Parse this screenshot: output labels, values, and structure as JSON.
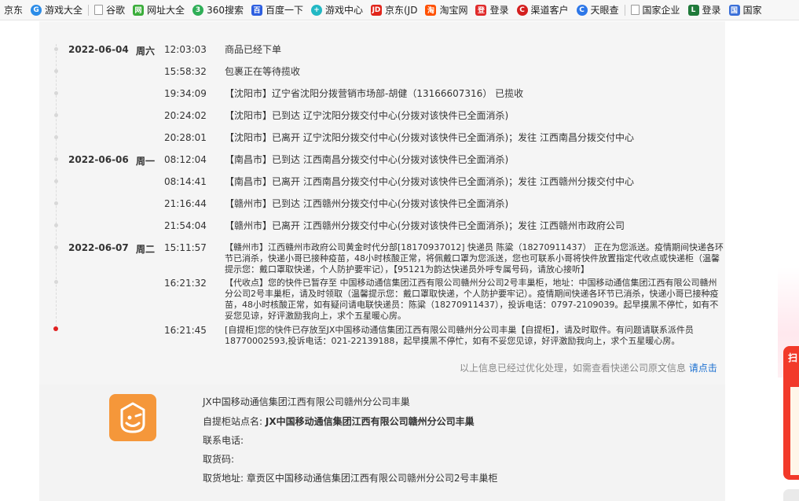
{
  "bookmarks": [
    {
      "label": "京东",
      "color": "#e1251b",
      "ico": ""
    },
    {
      "label": "游戏大全",
      "color": "#2b8ce8",
      "ico": "G"
    },
    {
      "label": "谷歌",
      "color": "",
      "ico": "doc"
    },
    {
      "label": "网址大全",
      "color": "#3cae3c",
      "ico": "网"
    },
    {
      "label": "360搜索",
      "color": "#2fae57",
      "ico": "3"
    },
    {
      "label": "百度一下",
      "color": "#2e5fe0",
      "ico": "百"
    },
    {
      "label": "游戏中心",
      "color": "#22b8c4",
      "ico": "+"
    },
    {
      "label": "京东(JD",
      "color": "#e1251b",
      "ico": "JD"
    },
    {
      "label": "淘宝网",
      "color": "#ff5000",
      "ico": "淘"
    },
    {
      "label": "登录",
      "color": "#e02b2b",
      "ico": "登"
    },
    {
      "label": "渠道客户",
      "color": "#d42020",
      "ico": "C"
    },
    {
      "label": "天眼查",
      "color": "#2d77e8",
      "ico": "C"
    },
    {
      "label": "国家企业",
      "color": "",
      "ico": "doc"
    },
    {
      "label": "登录",
      "color": "#1f7a3a",
      "ico": "L"
    },
    {
      "label": "国家",
      "color": "#3a6fd8",
      "ico": "国"
    }
  ],
  "timeline": {
    "groups": [
      {
        "date": "2022-06-04",
        "weekday": "周六"
      },
      {
        "date": "2022-06-06",
        "weekday": "周一"
      },
      {
        "date": "2022-06-07",
        "weekday": "周二"
      }
    ],
    "events": [
      {
        "time": "12:03:03",
        "text": "商品已经下单"
      },
      {
        "time": "15:58:32",
        "text": "包裹正在等待揽收"
      },
      {
        "time": "19:34:09",
        "text": "【沈阳市】辽宁省沈阳分拨营销市场部-胡健（13166607316） 已揽收"
      },
      {
        "time": "20:24:02",
        "text": "【沈阳市】已到达 辽宁沈阳分拨交付中心(分拨对该快件已全面消杀)"
      },
      {
        "time": "20:28:01",
        "text": "【沈阳市】已离开 辽宁沈阳分拨交付中心(分拨对该快件已全面消杀)；发往 江西南昌分拨交付中心"
      },
      {
        "time": "08:12:04",
        "text": "【南昌市】已到达 江西南昌分拨交付中心(分拨对该快件已全面消杀)"
      },
      {
        "time": "08:14:41",
        "text": "【南昌市】已离开 江西南昌分拨交付中心(分拨对该快件已全面消杀)；发往 江西赣州分拨交付中心"
      },
      {
        "time": "21:16:44",
        "text": "【赣州市】已到达 江西赣州分拨交付中心(分拨对该快件已全面消杀)"
      },
      {
        "time": "21:54:04",
        "text": "【赣州市】已离开 江西赣州分拨交付中心(分拨对该快件已全面消杀)；发往 江西赣州市政府公司"
      },
      {
        "time": "15:11:57",
        "text": "【赣州市】江西赣州市政府公司黄金时代分部[18170937012] 快递员 陈粱（18270911437） 正在为您派送。疫情期间快递各环节已消杀，快递小哥已接种疫苗，48小时核酸正常，将佩戴口罩为您派送，您也可联系小哥将快件放置指定代收点或快递柜（温馨提示您：戴口罩取快递，个人防护要牢记），【95121为韵达快递员外呼专属号码，请放心接听】"
      },
      {
        "time": "16:21:32",
        "text": "【代收点】您的快件已暂存至 中国移动通信集团江西有限公司赣州分公司2号丰巢柜，地址：中国移动通信集团江西有限公司赣州分公司2号丰巢柜，请及时领取（温馨提示您：戴口罩取快递，个人防护要牢记）。疫情期间快递各环节已消杀，快递小哥已接种疫苗，48小时核酸正常，如有疑问请电联快递员：陈粱（18270911437），投诉电话：0797-2109039。起早摸黑不停忙，如有不妥您见谅，好评激励我向上，求个五星暖心房。"
      },
      {
        "time": "16:21:45",
        "text": "[自提柜]您的快件已存放至JX中国移动通信集团江西有限公司赣州分公司丰巢【自提柜】，请及时取件。有问题请联系派件员18770002593,投诉电话：021-22139188，起早摸黑不停忙，如有不妥您见谅，好评激励我向上，求个五星暖心房。"
      }
    ]
  },
  "note": {
    "text": "以上信息已经过优化处理，如需查看快递公司原文信息",
    "link": "请点击"
  },
  "pickup": {
    "name": "JX中国移动通信集团江西有限公司赣州分公司丰巢",
    "station_label": "自提柜站点名:",
    "station_value": "JX中国移动通信集团江西有限公司赣州分公司丰巢",
    "phone_label": "联系电话:",
    "phone_value": "",
    "code_label": "取货码:",
    "code_value": "",
    "address_label": "取货地址:",
    "address_value": "章贡区中国移动通信集团江西有限公司赣州分公司2号丰巢柜"
  },
  "side_ad": {
    "text": "扫"
  },
  "colors": {
    "accent": "#f5973a",
    "link": "#1a6fd0",
    "latest_dot": "#e02020"
  }
}
